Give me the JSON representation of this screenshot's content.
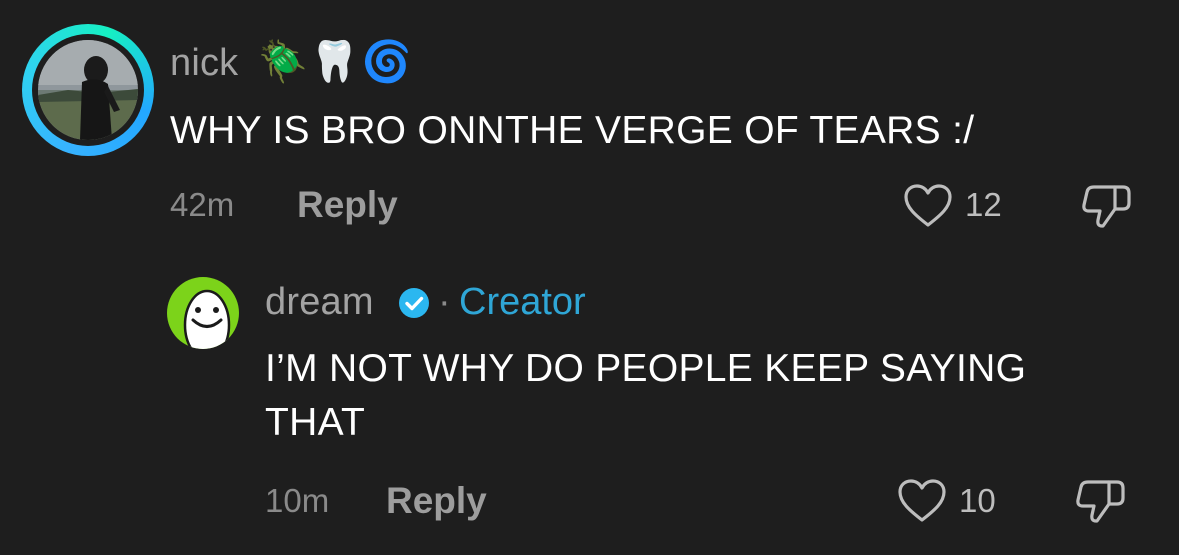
{
  "comments": [
    {
      "username": "nick",
      "emojis": [
        "🪲",
        "🦷",
        "🌀"
      ],
      "text": "WHY IS BRO ONNTHE VERGE OF TEARS :/",
      "time": "42m",
      "reply_label": "Reply",
      "likes": "12"
    },
    {
      "username": "dream",
      "creator_label": "Creator",
      "separator": "·",
      "text_lines": [
        "I’M NOT WHY DO PEOPLE KEEP SAYING",
        "THAT"
      ],
      "time": "10m",
      "reply_label": "Reply",
      "likes": "10"
    }
  ],
  "colors": {
    "background": "#1e1e1e",
    "creator": "#2fa6d6",
    "verified": "#2bb7f0",
    "dream_avatar": "#7cd31a"
  }
}
